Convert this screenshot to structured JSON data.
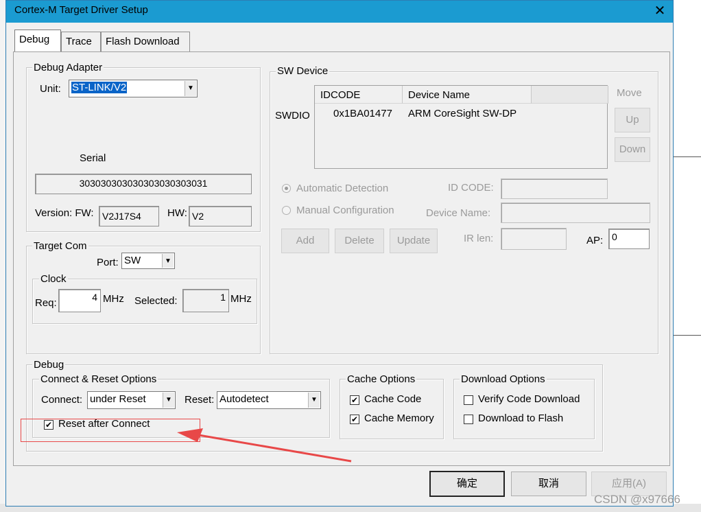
{
  "window": {
    "title": "Cortex-M Target Driver Setup",
    "close_glyph": "✕"
  },
  "tabs": [
    {
      "label": "Debug",
      "active": true
    },
    {
      "label": "Trace",
      "active": false
    },
    {
      "label": "Flash Download",
      "active": false
    }
  ],
  "debug_adapter": {
    "group_label": "Debug Adapter",
    "unit_label": "Unit:",
    "unit_value": "ST-LINK/V2",
    "serial_label": "Serial",
    "serial_value": "303030303030303030303031",
    "version_label": "Version: FW:",
    "fw_value": "V2J17S4",
    "hw_label": "HW:",
    "hw_value": "V2"
  },
  "target_com": {
    "group_label": "Target Com",
    "port_label": "Port:",
    "port_value": "SW",
    "clock_label": "Clock",
    "req_label": "Req:",
    "req_value": "4",
    "req_unit": "MHz",
    "selected_label": "Selected:",
    "selected_value": "1",
    "selected_unit": "MHz"
  },
  "sw_device": {
    "group_label": "SW Device",
    "swdio_label": "SWDIO",
    "columns": [
      "IDCODE",
      "Device Name"
    ],
    "rows": [
      {
        "idcode": "0x1BA01477",
        "name": "ARM CoreSight SW-DP"
      }
    ],
    "move_label": "Move",
    "up_label": "Up",
    "down_label": "Down",
    "auto_detection_label": "Automatic Detection",
    "manual_config_label": "Manual Configuration",
    "id_code_label": "ID CODE:",
    "device_name_label": "Device Name:",
    "ir_len_label": "IR len:",
    "ap_label": "AP:",
    "ap_value": "0",
    "add_label": "Add",
    "delete_label": "Delete",
    "update_label": "Update"
  },
  "debug": {
    "group_label": "Debug",
    "connect_reset": {
      "group_label": "Connect & Reset Options",
      "connect_label": "Connect:",
      "connect_value": "under Reset",
      "reset_label": "Reset:",
      "reset_value": "Autodetect",
      "reset_after_connect_label": "Reset after Connect",
      "reset_after_connect_checked": true
    },
    "cache": {
      "group_label": "Cache Options",
      "cache_code_label": "Cache Code",
      "cache_code_checked": true,
      "cache_memory_label": "Cache Memory",
      "cache_memory_checked": true
    },
    "download": {
      "group_label": "Download Options",
      "verify_label": "Verify Code Download",
      "verify_checked": false,
      "download_flash_label": "Download to Flash",
      "download_flash_checked": false
    }
  },
  "footer": {
    "ok_label": "确定",
    "cancel_label": "取消",
    "apply_label": "应用(A)"
  },
  "watermark": "CSDN @x97666",
  "colors": {
    "titlebar": "#1b9bd1",
    "annotation": "#e84848",
    "selection": "#0a64c8"
  }
}
